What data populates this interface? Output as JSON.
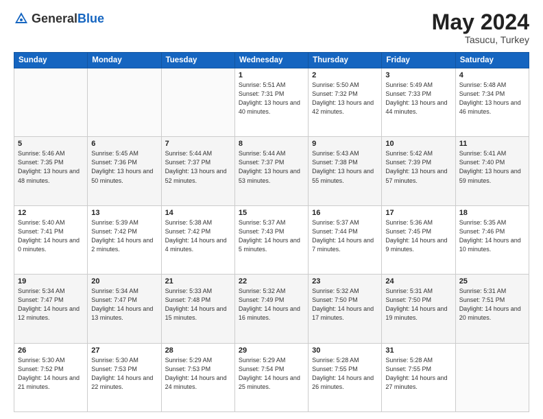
{
  "header": {
    "logo_general": "General",
    "logo_blue": "Blue",
    "month_year": "May 2024",
    "location": "Tasucu, Turkey"
  },
  "days_of_week": [
    "Sunday",
    "Monday",
    "Tuesday",
    "Wednesday",
    "Thursday",
    "Friday",
    "Saturday"
  ],
  "weeks": [
    [
      {
        "day": "",
        "sunrise": "",
        "sunset": "",
        "daylight": ""
      },
      {
        "day": "",
        "sunrise": "",
        "sunset": "",
        "daylight": ""
      },
      {
        "day": "",
        "sunrise": "",
        "sunset": "",
        "daylight": ""
      },
      {
        "day": "1",
        "sunrise": "Sunrise: 5:51 AM",
        "sunset": "Sunset: 7:31 PM",
        "daylight": "Daylight: 13 hours and 40 minutes."
      },
      {
        "day": "2",
        "sunrise": "Sunrise: 5:50 AM",
        "sunset": "Sunset: 7:32 PM",
        "daylight": "Daylight: 13 hours and 42 minutes."
      },
      {
        "day": "3",
        "sunrise": "Sunrise: 5:49 AM",
        "sunset": "Sunset: 7:33 PM",
        "daylight": "Daylight: 13 hours and 44 minutes."
      },
      {
        "day": "4",
        "sunrise": "Sunrise: 5:48 AM",
        "sunset": "Sunset: 7:34 PM",
        "daylight": "Daylight: 13 hours and 46 minutes."
      }
    ],
    [
      {
        "day": "5",
        "sunrise": "Sunrise: 5:46 AM",
        "sunset": "Sunset: 7:35 PM",
        "daylight": "Daylight: 13 hours and 48 minutes."
      },
      {
        "day": "6",
        "sunrise": "Sunrise: 5:45 AM",
        "sunset": "Sunset: 7:36 PM",
        "daylight": "Daylight: 13 hours and 50 minutes."
      },
      {
        "day": "7",
        "sunrise": "Sunrise: 5:44 AM",
        "sunset": "Sunset: 7:37 PM",
        "daylight": "Daylight: 13 hours and 52 minutes."
      },
      {
        "day": "8",
        "sunrise": "Sunrise: 5:44 AM",
        "sunset": "Sunset: 7:37 PM",
        "daylight": "Daylight: 13 hours and 53 minutes."
      },
      {
        "day": "9",
        "sunrise": "Sunrise: 5:43 AM",
        "sunset": "Sunset: 7:38 PM",
        "daylight": "Daylight: 13 hours and 55 minutes."
      },
      {
        "day": "10",
        "sunrise": "Sunrise: 5:42 AM",
        "sunset": "Sunset: 7:39 PM",
        "daylight": "Daylight: 13 hours and 57 minutes."
      },
      {
        "day": "11",
        "sunrise": "Sunrise: 5:41 AM",
        "sunset": "Sunset: 7:40 PM",
        "daylight": "Daylight: 13 hours and 59 minutes."
      }
    ],
    [
      {
        "day": "12",
        "sunrise": "Sunrise: 5:40 AM",
        "sunset": "Sunset: 7:41 PM",
        "daylight": "Daylight: 14 hours and 0 minutes."
      },
      {
        "day": "13",
        "sunrise": "Sunrise: 5:39 AM",
        "sunset": "Sunset: 7:42 PM",
        "daylight": "Daylight: 14 hours and 2 minutes."
      },
      {
        "day": "14",
        "sunrise": "Sunrise: 5:38 AM",
        "sunset": "Sunset: 7:42 PM",
        "daylight": "Daylight: 14 hours and 4 minutes."
      },
      {
        "day": "15",
        "sunrise": "Sunrise: 5:37 AM",
        "sunset": "Sunset: 7:43 PM",
        "daylight": "Daylight: 14 hours and 5 minutes."
      },
      {
        "day": "16",
        "sunrise": "Sunrise: 5:37 AM",
        "sunset": "Sunset: 7:44 PM",
        "daylight": "Daylight: 14 hours and 7 minutes."
      },
      {
        "day": "17",
        "sunrise": "Sunrise: 5:36 AM",
        "sunset": "Sunset: 7:45 PM",
        "daylight": "Daylight: 14 hours and 9 minutes."
      },
      {
        "day": "18",
        "sunrise": "Sunrise: 5:35 AM",
        "sunset": "Sunset: 7:46 PM",
        "daylight": "Daylight: 14 hours and 10 minutes."
      }
    ],
    [
      {
        "day": "19",
        "sunrise": "Sunrise: 5:34 AM",
        "sunset": "Sunset: 7:47 PM",
        "daylight": "Daylight: 14 hours and 12 minutes."
      },
      {
        "day": "20",
        "sunrise": "Sunrise: 5:34 AM",
        "sunset": "Sunset: 7:47 PM",
        "daylight": "Daylight: 14 hours and 13 minutes."
      },
      {
        "day": "21",
        "sunrise": "Sunrise: 5:33 AM",
        "sunset": "Sunset: 7:48 PM",
        "daylight": "Daylight: 14 hours and 15 minutes."
      },
      {
        "day": "22",
        "sunrise": "Sunrise: 5:32 AM",
        "sunset": "Sunset: 7:49 PM",
        "daylight": "Daylight: 14 hours and 16 minutes."
      },
      {
        "day": "23",
        "sunrise": "Sunrise: 5:32 AM",
        "sunset": "Sunset: 7:50 PM",
        "daylight": "Daylight: 14 hours and 17 minutes."
      },
      {
        "day": "24",
        "sunrise": "Sunrise: 5:31 AM",
        "sunset": "Sunset: 7:50 PM",
        "daylight": "Daylight: 14 hours and 19 minutes."
      },
      {
        "day": "25",
        "sunrise": "Sunrise: 5:31 AM",
        "sunset": "Sunset: 7:51 PM",
        "daylight": "Daylight: 14 hours and 20 minutes."
      }
    ],
    [
      {
        "day": "26",
        "sunrise": "Sunrise: 5:30 AM",
        "sunset": "Sunset: 7:52 PM",
        "daylight": "Daylight: 14 hours and 21 minutes."
      },
      {
        "day": "27",
        "sunrise": "Sunrise: 5:30 AM",
        "sunset": "Sunset: 7:53 PM",
        "daylight": "Daylight: 14 hours and 22 minutes."
      },
      {
        "day": "28",
        "sunrise": "Sunrise: 5:29 AM",
        "sunset": "Sunset: 7:53 PM",
        "daylight": "Daylight: 14 hours and 24 minutes."
      },
      {
        "day": "29",
        "sunrise": "Sunrise: 5:29 AM",
        "sunset": "Sunset: 7:54 PM",
        "daylight": "Daylight: 14 hours and 25 minutes."
      },
      {
        "day": "30",
        "sunrise": "Sunrise: 5:28 AM",
        "sunset": "Sunset: 7:55 PM",
        "daylight": "Daylight: 14 hours and 26 minutes."
      },
      {
        "day": "31",
        "sunrise": "Sunrise: 5:28 AM",
        "sunset": "Sunset: 7:55 PM",
        "daylight": "Daylight: 14 hours and 27 minutes."
      },
      {
        "day": "",
        "sunrise": "",
        "sunset": "",
        "daylight": ""
      }
    ]
  ]
}
